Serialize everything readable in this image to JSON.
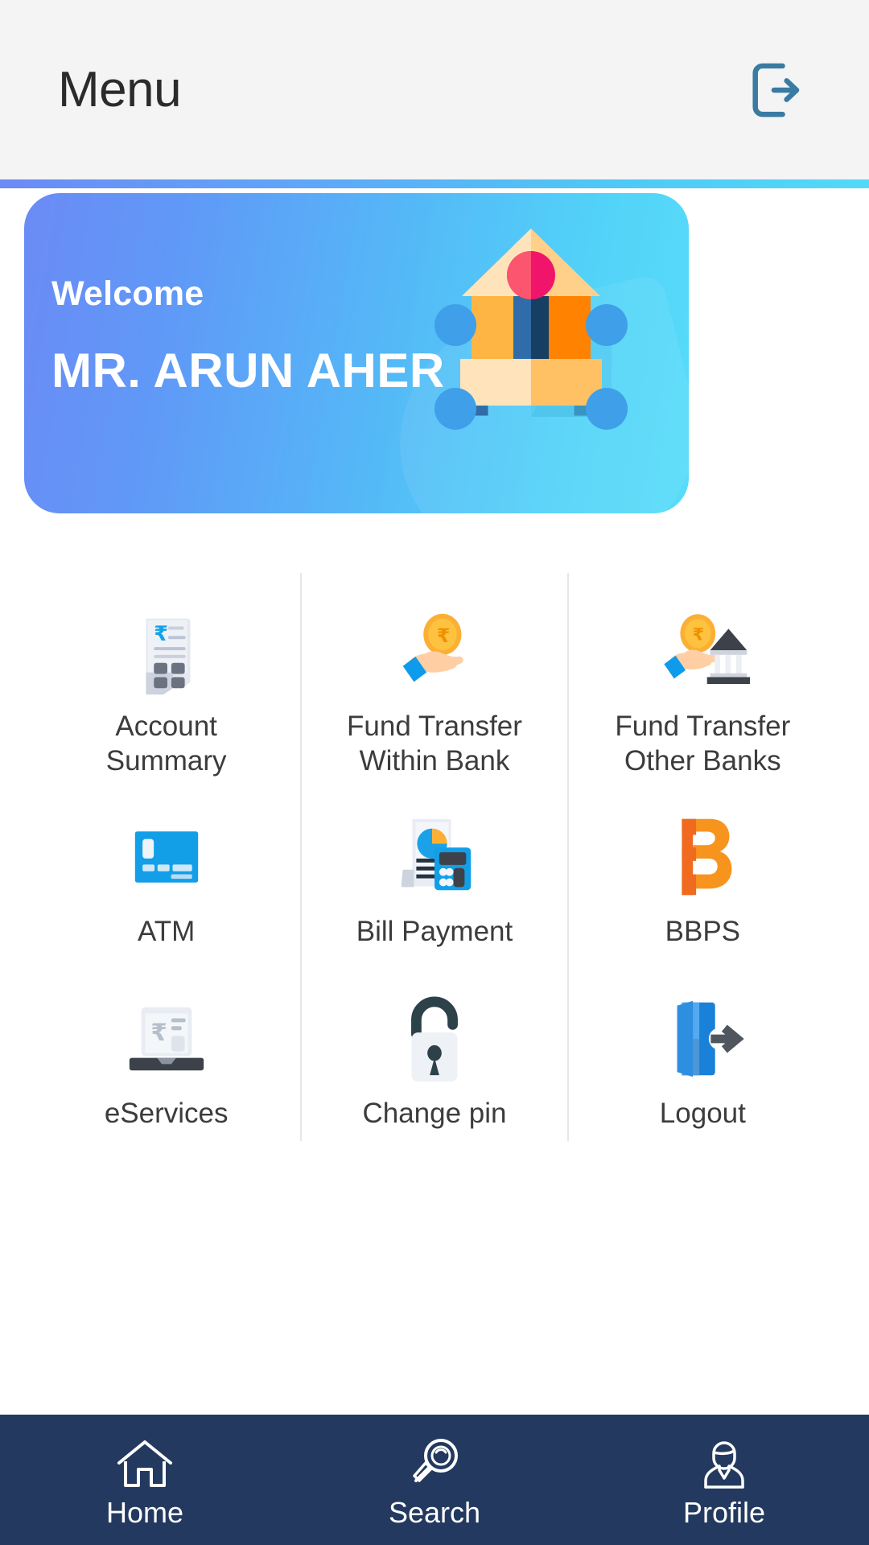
{
  "header": {
    "title": "Menu",
    "logout_icon": "logout-icon"
  },
  "colors": {
    "header_bg": "#f4f4f4",
    "accent_bar_start": "#6b8bf5",
    "accent_bar_end": "#52d9f8",
    "card_gradient_start": "#6b8bf5",
    "card_gradient_end": "#57dcf9",
    "nav_bg": "#23395f",
    "divider": "#e6e7ea",
    "label_text": "#3c3c3c"
  },
  "welcome_card": {
    "greeting": "Welcome",
    "user_name": "MR. ARUN AHER",
    "illustration": "bank-building-network-icon"
  },
  "menu": {
    "tiles": [
      {
        "label": "Account Summary",
        "icon": "receipt-rupee-icon"
      },
      {
        "label": "Fund Transfer Within Bank",
        "line1": "Fund Transfer",
        "line2": "Within Bank",
        "icon": "hand-rupee-coin-icon"
      },
      {
        "label": "Fund Transfer Other Banks",
        "line1": "Fund Transfer",
        "line2": "Other Banks",
        "icon": "hand-coin-bank-icon"
      },
      {
        "label": "ATM",
        "icon": "debit-card-icon"
      },
      {
        "label": "Bill Payment",
        "icon": "invoice-calculator-icon"
      },
      {
        "label": "BBPS",
        "icon": "bbps-logo-icon"
      },
      {
        "label": "eServices",
        "icon": "laptop-rupee-icon"
      },
      {
        "label": "Change pin",
        "icon": "padlock-icon"
      },
      {
        "label": "Logout",
        "icon": "door-exit-icon"
      }
    ]
  },
  "bottom_nav": {
    "items": [
      {
        "label": "Home",
        "icon": "home-icon"
      },
      {
        "label": "Search",
        "icon": "search-icon"
      },
      {
        "label": "Profile",
        "icon": "profile-icon"
      }
    ]
  }
}
